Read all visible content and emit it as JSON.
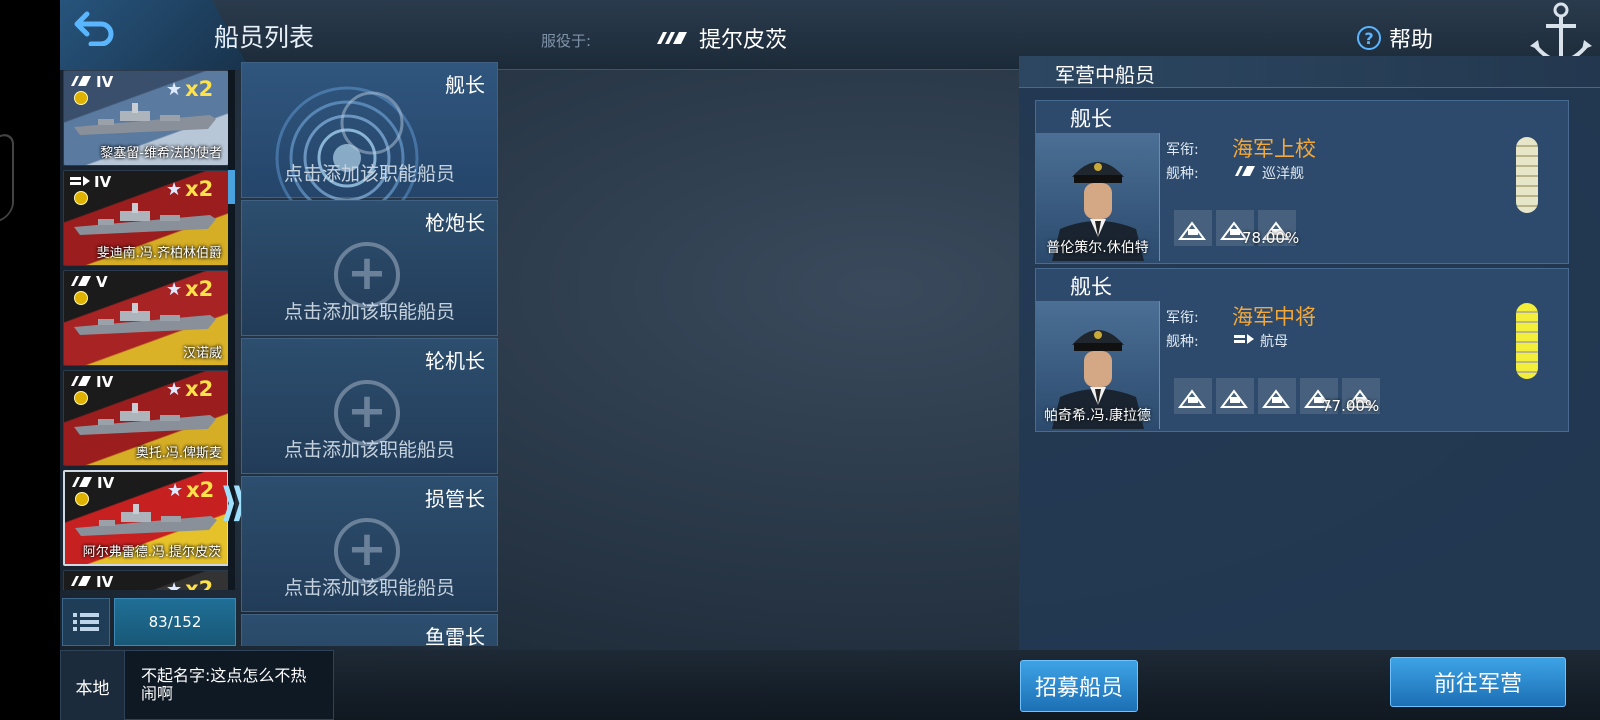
{
  "header": {
    "title": "船员列表",
    "serve_label": "服役于:",
    "serve_ship": "提尔皮茨",
    "help": "帮助"
  },
  "ships": [
    {
      "tier": "IV",
      "stars": "x2",
      "name": "黎塞留-维希法的使者",
      "type_icon": "cruiser-icon",
      "flag_colors": [
        "#3a4f6b",
        "#5a7aa0",
        "#b8c7d8"
      ]
    },
    {
      "tier": "IV",
      "stars": "x2",
      "name": "斐迪南.冯.齐柏林伯爵",
      "type_icon": "carrier-icon",
      "flag_colors": [
        "#1b1b1b",
        "#9b1d1d",
        "#d6ae25"
      ]
    },
    {
      "tier": "V",
      "stars": "x2",
      "name": "汉诺威",
      "type_icon": "cruiser-icon",
      "flag_colors": [
        "#1b1b1b",
        "#a82323",
        "#d9b228"
      ]
    },
    {
      "tier": "IV",
      "stars": "x2",
      "name": "奥托.冯.俾斯麦",
      "type_icon": "cruiser-icon",
      "flag_colors": [
        "#1b1b1b",
        "#9b1d1d",
        "#d6ae25"
      ]
    },
    {
      "tier": "IV",
      "stars": "x2",
      "name": "阿尔弗雷德.冯.提尔皮茨",
      "type_icon": "cruiser-icon",
      "flag_colors": [
        "#1b1b1b",
        "#c62020",
        "#e6c22a"
      ]
    },
    {
      "tier": "IV",
      "stars": "x2",
      "name": "",
      "type_icon": "cruiser-icon",
      "flag_colors": [
        "#1b1b1b",
        "#333",
        "#555"
      ]
    }
  ],
  "list_count": "83/152",
  "slots": [
    {
      "role": "舰长",
      "hint": "点击添加该职能船员"
    },
    {
      "role": "枪炮长",
      "hint": "点击添加该职能船员"
    },
    {
      "role": "轮机长",
      "hint": "点击添加该职能船员"
    },
    {
      "role": "损管长",
      "hint": "点击添加该职能船员"
    },
    {
      "role": "鱼雷长",
      "hint": ""
    }
  ],
  "camp": {
    "title": "军营中船员",
    "rank_label": "军衔:",
    "type_label": "舰种:",
    "crew": [
      {
        "role": "舰长",
        "name": "普伦策尔.休伯特",
        "rank": "海军上校",
        "ship_type": "巡洋舰",
        "ship_type_icon": "cruiser-icon",
        "skill_pct": "78.00%",
        "epaulette_color": "#e8e6c8"
      },
      {
        "role": "舰长",
        "name": "帕奇希.冯.康拉德",
        "rank": "海军中将",
        "ship_type": "航母",
        "ship_type_icon": "carrier-icon",
        "skill_pct": "77.00%",
        "epaulette_color": "#f3ee3a"
      }
    ]
  },
  "chat": {
    "channel": "本地",
    "message": "不起名字:这点怎么不热闹啊"
  },
  "buttons": {
    "recruit": "招募船员",
    "goto_barracks": "前往军营"
  },
  "colors": {
    "accent_blue": "#3da3e6",
    "rank_orange": "#f3a839"
  }
}
